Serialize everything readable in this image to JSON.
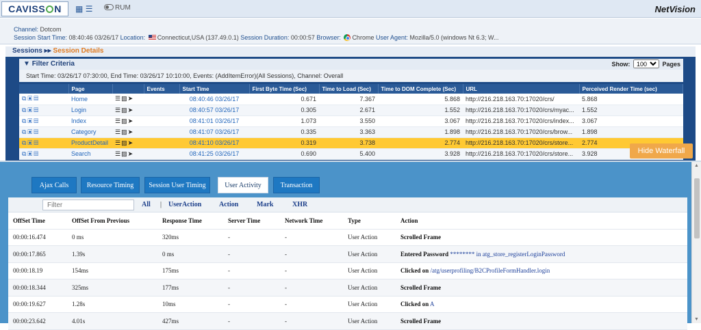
{
  "header": {
    "logo": "CAVISSON",
    "rum_label": "RUM",
    "brand": "NetVision"
  },
  "session_info": {
    "channel_label": "Channel:",
    "channel_value": "Dotcom",
    "start_label": "Session Start Time:",
    "start_value": "08:40:46 03/26/17",
    "location_label": "Location:",
    "location_value": "Connecticut,USA (137.49.0.1)",
    "duration_label": "Session Duration:",
    "duration_value": "00:00:57",
    "browser_label": "Browser:",
    "browser_value": "Chrome",
    "agent_label": "User Agent:",
    "agent_value": "Mozilla/5.0 (windows Nt 6.3; W..."
  },
  "breadcrumb": {
    "sessions": "Sessions",
    "arrow": "▸▸",
    "current": "Session Details"
  },
  "filter": {
    "title": "Filter Criteria",
    "arrow": "▼",
    "show_label": "Show:",
    "show_value": "100",
    "pages_label": "Pages",
    "criteria": "Start Time: 03/26/17 07:30:00, End Time: 03/26/17 10:10:00, Events: (AddItemError)(All Sessions), Channel: Overall"
  },
  "pages_table": {
    "columns": [
      "",
      "Page",
      "",
      "Events",
      "Start Time",
      "First Byte Time (Sec)",
      "Time to Load (Sec)",
      "Time to DOM Complete (Sec)",
      "URL",
      "Perceived Render Time (sec)"
    ],
    "rows": [
      {
        "page": "Home",
        "start": "08:40:46 03/26/17",
        "fbt": "0.671",
        "ttl": "7.367",
        "dom": "5.868",
        "url": "http://216.218.163.70:17020/crs/",
        "prt": "5.868"
      },
      {
        "page": "Login",
        "start": "08:40:57 03/26/17",
        "fbt": "0.305",
        "ttl": "2.671",
        "dom": "1.552",
        "url": "http://216.218.163.70:17020/crs/myac...",
        "prt": "1.552"
      },
      {
        "page": "Index",
        "start": "08:41:01 03/26/17",
        "fbt": "1.073",
        "ttl": "3.550",
        "dom": "3.067",
        "url": "http://216.218.163.70:17020/crs/index...",
        "prt": "3.067"
      },
      {
        "page": "Category",
        "start": "08:41:07 03/26/17",
        "fbt": "0.335",
        "ttl": "3.363",
        "dom": "1.898",
        "url": "http://216.218.163.70:17020/crs/brow...",
        "prt": "1.898"
      },
      {
        "page": "ProductDetail",
        "start": "08:41:10 03/26/17",
        "fbt": "0.319",
        "ttl": "3.738",
        "dom": "2.774",
        "url": "http://216.218.163.70:17020/crs/store...",
        "prt": "2.774"
      },
      {
        "page": "Search",
        "start": "08:41:25 03/26/17",
        "fbt": "0.690",
        "ttl": "5.400",
        "dom": "3.928",
        "url": "http://216.218.163.70:17020/crs/store...",
        "prt": "3.928"
      }
    ]
  },
  "hide_waterfall": "Hide Waterfall",
  "tabs": [
    "Ajax Calls",
    "Resource Timing",
    "Session User Timing",
    "User Activity",
    "Transaction"
  ],
  "activity_filters": {
    "placeholder": "Filter",
    "all": "All",
    "sep": "|",
    "user_action": "UserAction",
    "action": "Action",
    "mark": "Mark",
    "xhr": "XHR"
  },
  "activity_table": {
    "columns": [
      "OffSet Time",
      "OffSet From Previous",
      "Response Time",
      "Server Time",
      "Network Time",
      "Type",
      "Action"
    ],
    "rows": [
      {
        "offset": "00:00:16.474",
        "prev": "0 ms",
        "resp": "320ms",
        "server": "-",
        "network": "-",
        "type": "User Action",
        "act_bold": "Scrolled Frame",
        "act_link": ""
      },
      {
        "offset": "00:00:17.865",
        "prev": "1.39s",
        "resp": "0 ms",
        "server": "-",
        "network": "-",
        "type": "User Action",
        "act_bold": "Entered Password",
        "act_link": "******** in atg_store_registerLoginPassword"
      },
      {
        "offset": "00:00:18.19",
        "prev": "154ms",
        "resp": "175ms",
        "server": "-",
        "network": "-",
        "type": "User Action",
        "act_bold": "Clicked on",
        "act_link": "/atg/userprofiling/B2CProfileFormHandler.login"
      },
      {
        "offset": "00:00:18.344",
        "prev": "325ms",
        "resp": "177ms",
        "server": "-",
        "network": "-",
        "type": "User Action",
        "act_bold": "Scrolled Frame",
        "act_link": ""
      },
      {
        "offset": "00:00:19.627",
        "prev": "1.28s",
        "resp": "10ms",
        "server": "-",
        "network": "-",
        "type": "User Action",
        "act_bold": "Clicked on",
        "act_link": "A"
      },
      {
        "offset": "00:00:23.642",
        "prev": "4.01s",
        "resp": "427ms",
        "server": "-",
        "network": "-",
        "type": "User Action",
        "act_bold": "Scrolled Frame",
        "act_link": ""
      }
    ]
  },
  "colors": {
    "selected_row": "#ffc933",
    "accent_orange": "#f0a84a",
    "tab_blue": "#1e78c2"
  }
}
